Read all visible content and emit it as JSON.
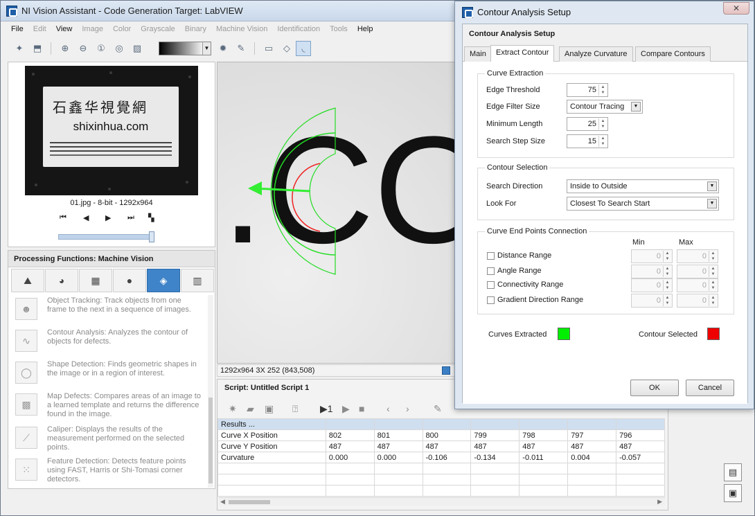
{
  "window": {
    "title": "NI Vision Assistant - Code Generation Target: LabVIEW"
  },
  "menu": [
    {
      "label": "File",
      "enabled": true
    },
    {
      "label": "Edit",
      "enabled": false
    },
    {
      "label": "View",
      "enabled": true
    },
    {
      "label": "Image",
      "enabled": false
    },
    {
      "label": "Color",
      "enabled": false
    },
    {
      "label": "Grayscale",
      "enabled": false
    },
    {
      "label": "Binary",
      "enabled": false
    },
    {
      "label": "Machine Vision",
      "enabled": false
    },
    {
      "label": "Identification",
      "enabled": false
    },
    {
      "label": "Tools",
      "enabled": false
    },
    {
      "label": "Help",
      "enabled": true
    }
  ],
  "thumbnail": {
    "line1": "石鑫华視覺網",
    "line2": "shixinhua.com",
    "caption": "01.jpg - 8-bit - 1292x964"
  },
  "processing_functions": {
    "header": "Processing Functions: Machine Vision",
    "items": [
      {
        "text": "Object Tracking:  Track objects from one frame to the next in a sequence of images.",
        "icon": "object-tracking-icon"
      },
      {
        "text": "Contour Analysis:  Analyzes the contour of objects for defects.",
        "icon": "contour-analysis-icon"
      },
      {
        "text": "Shape Detection:  Finds geometric shapes in the image or in a region of interest.",
        "icon": "shape-detection-icon"
      },
      {
        "text": "Map Defects:  Compares areas of an image to a learned template and returns the difference found in the image.",
        "icon": "map-defects-icon"
      },
      {
        "text": "Caliper:  Displays the results of the measurement performed on the selected points.",
        "icon": "caliper-icon"
      },
      {
        "text": "Feature Detection:  Detects feature points using FAST, Harris or Shi-Tomasi corner detectors.",
        "icon": "feature-detection-icon"
      }
    ]
  },
  "viewer": {
    "status": "1292x964 3X 252   (843,508)",
    "overlay_text": ".CO"
  },
  "script": {
    "title": "Script: Untitled Script 1",
    "results_header": "Results ...",
    "rows": [
      {
        "label": "Curve X Position",
        "values": [
          "802",
          "801",
          "800",
          "799",
          "798",
          "797",
          "796"
        ]
      },
      {
        "label": "Curve Y Position",
        "values": [
          "487",
          "487",
          "487",
          "487",
          "487",
          "487",
          "487"
        ]
      },
      {
        "label": "Curvature",
        "values": [
          "0.000",
          "0.000",
          "-0.106",
          "-0.134",
          "-0.011",
          "0.004",
          "-0.057"
        ]
      }
    ]
  },
  "dialog": {
    "title": "Contour Analysis Setup",
    "header": "Contour Analysis Setup",
    "tabs": [
      "Main",
      "Extract Contour",
      "Analyze Curvature",
      "Compare Contours"
    ],
    "active_tab": "Extract Contour",
    "curve_extraction": {
      "title": "Curve Extraction",
      "edge_threshold_label": "Edge Threshold",
      "edge_threshold": "75",
      "edge_filter_label": "Edge Filter Size",
      "edge_filter": "Contour Tracing",
      "min_length_label": "Minimum Length",
      "min_length": "25",
      "search_step_label": "Search Step Size",
      "search_step": "15"
    },
    "contour_selection": {
      "title": "Contour Selection",
      "search_direction_label": "Search Direction",
      "search_direction": "Inside to Outside",
      "look_for_label": "Look For",
      "look_for": "Closest To Search Start"
    },
    "end_points": {
      "title": "Curve End Points Connection",
      "min_label": "Min",
      "max_label": "Max",
      "rows": [
        {
          "label": "Distance Range",
          "min": "0",
          "max": "0"
        },
        {
          "label": "Angle Range",
          "min": "0",
          "max": "0"
        },
        {
          "label": "Connectivity Range",
          "min": "0",
          "max": "0"
        },
        {
          "label": "Gradient Direction Range",
          "min": "0",
          "max": "0"
        }
      ]
    },
    "legend": {
      "curves_label": "Curves Extracted",
      "curves_color": "#00ee00",
      "selected_label": "Contour Selected",
      "selected_color": "#ee0000"
    },
    "ok": "OK",
    "cancel": "Cancel"
  }
}
